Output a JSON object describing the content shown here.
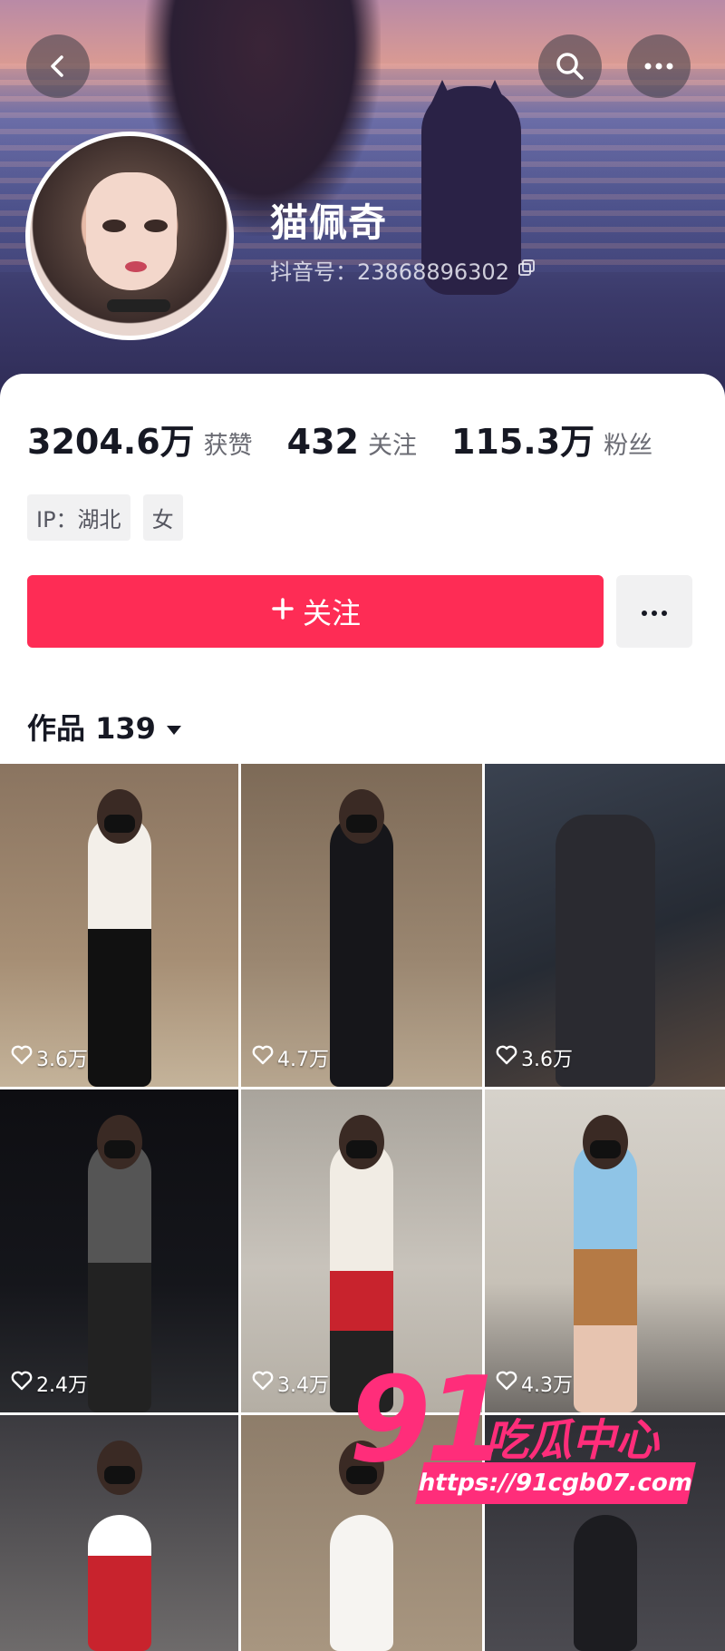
{
  "header": {
    "back_icon": "chevron-left-icon",
    "search_icon": "search-icon",
    "more_icon": "ellipsis-icon"
  },
  "profile": {
    "name": "猫佩奇",
    "douyin_id": "抖音号：23868896302",
    "copy_icon": "copy-icon"
  },
  "stats": [
    {
      "value": "3204.6万",
      "label": "获赞"
    },
    {
      "value": "432",
      "label": "关注"
    },
    {
      "value": "115.3万",
      "label": "粉丝"
    }
  ],
  "tags": [
    "IP：湖北",
    "女"
  ],
  "actions": {
    "follow_label": "关注",
    "follow_icon": "plus-icon",
    "more_icon": "ellipsis-icon"
  },
  "works": {
    "title": "作品 139",
    "dropdown_icon": "caret-down-icon",
    "items": [
      {
        "likes": "3.6万"
      },
      {
        "likes": "4.7万"
      },
      {
        "likes": "3.6万"
      },
      {
        "likes": "2.4万"
      },
      {
        "likes": "3.4万"
      },
      {
        "likes": "4.3万"
      },
      {
        "likes": ""
      },
      {
        "likes": ""
      },
      {
        "likes": ""
      }
    ]
  },
  "watermark": {
    "number": "91",
    "text": "吃瓜中心",
    "url": "https://91cgb07.com"
  },
  "colors": {
    "accent": "#fe2c55",
    "watermark": "#ff2d7a"
  }
}
